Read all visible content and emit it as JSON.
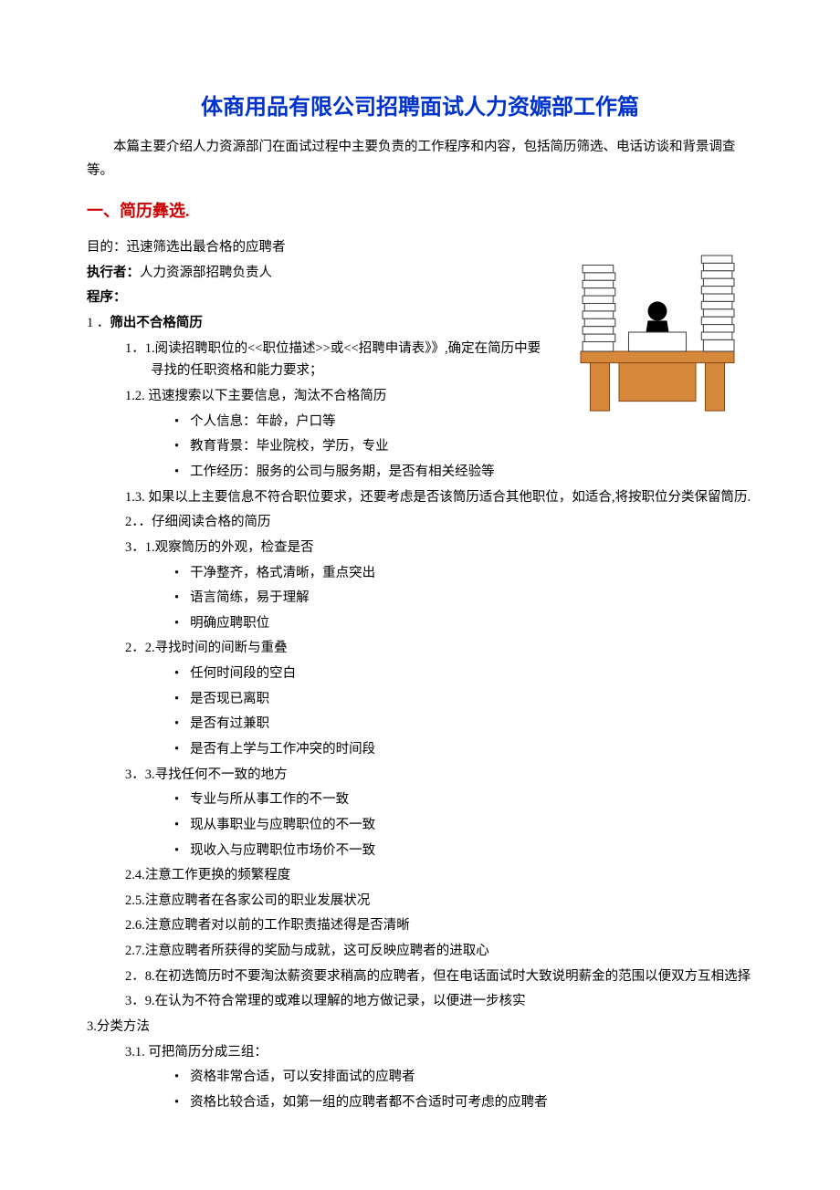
{
  "title": "体商用品有限公司招聘面试人力资嫄部工作篇",
  "intro": "本篇主要介绍人力资源部门在面试过程中主要负责的工作程序和内容，包括简历筛选、电话访谈和背景调查等。",
  "section1": {
    "heading": "一、简历彝选.",
    "purpose_label": "目的：",
    "purpose_text": "迅速筛选出最合格的应聘者",
    "executor_label": "执行者：",
    "executor_text": "人力资源部招聘负责人",
    "procedure_label": "程序：",
    "step1": {
      "num": "1 ．",
      "title": "筛出不合格简历",
      "s11": "1．1.阅读招聘职位的<<职位描述>>或<<招聘申请表》》,确定在简历中要寻找的任职资格和能力要求；",
      "s12": "1.2. 迅速搜索以下主要信息，淘汰不合格简历",
      "s12_b1": "个人信息：年龄，户口等",
      "s12_b2": "教育背景：毕业院校，学历，专业",
      "s12_b3": "工作经历：服务的公司与服务期，是否有相关经验等",
      "s13": "1.3. 如果以上主要信息不符合职位要求，还要考虑是否该筒历适合其他职位，如适合,将按职位分类保留筒历."
    },
    "step2": {
      "s20": "2．．仔细阅读合格的简历",
      "s21": "3．1.观察筒历的外观，检查是否",
      "s21_b1": "干净整齐，格式清晰，重点突出",
      "s21_b2": "语言简练，易于理解",
      "s21_b3": "明确应聘职位",
      "s22": "2．2.寻找时间的间断与重叠",
      "s22_b1": "任何时间段的空白",
      "s22_b2": "是否现已离职",
      "s22_b3": "是否有过兼职",
      "s22_b4": "是否有上学与工作冲突的时间段",
      "s23": "3．3.寻找任何不一致的地方",
      "s23_b1": "专业与所从事工作的不一致",
      "s23_b2": "现从事职业与应聘职位的不一致",
      "s23_b3": "现收入与应聘职位市场价不一致",
      "s24": "2.4.注意工作更换的频繁程度",
      "s25": "2.5.注意应聘者在各家公司的职业发展状况",
      "s26": "2.6.注意应聘者对以前的工作职责描述得是否清晰",
      "s27": "2.7.注意应聘者所获得的奖励与成就，这可反映应聘者的进取心",
      "s28": "2．8.在初选筒历时不要淘汰薪资要求稍高的应聘者，但在电话面试时大致说明薪金的范围以便双方互相选择",
      "s29": "3．9.在认为不符合常理的或难以理解的地方做记录，以便进一步核实"
    },
    "step3": {
      "title": "3.分类方法",
      "s31": "3.1. 可把简历分成三组：",
      "s31_b1": "资格非常合适，可以安排面试的应聘者",
      "s31_b2": "资格比较合适，如第一组的应聘者都不合适时可考虑的应聘者"
    }
  }
}
